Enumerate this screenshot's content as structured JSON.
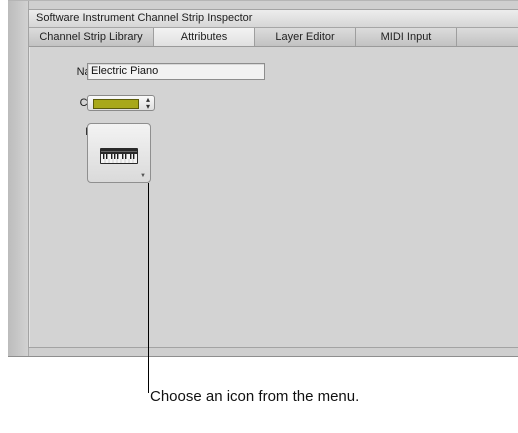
{
  "window": {
    "title": "Software Instrument Channel Strip Inspector"
  },
  "tabs": [
    {
      "label": "Channel Strip Library",
      "active": false
    },
    {
      "label": "Attributes",
      "active": true
    },
    {
      "label": "Layer Editor",
      "active": false
    },
    {
      "label": "MIDI Input",
      "active": false
    }
  ],
  "form": {
    "name_label": "Name:",
    "name_value": "Electric Piano",
    "color_label": "Color:",
    "color_value": "#a8a81a",
    "icon_label": "Icon:",
    "icon_name": "keyboard-icon"
  },
  "callout": {
    "text": "Choose an icon from the menu."
  }
}
